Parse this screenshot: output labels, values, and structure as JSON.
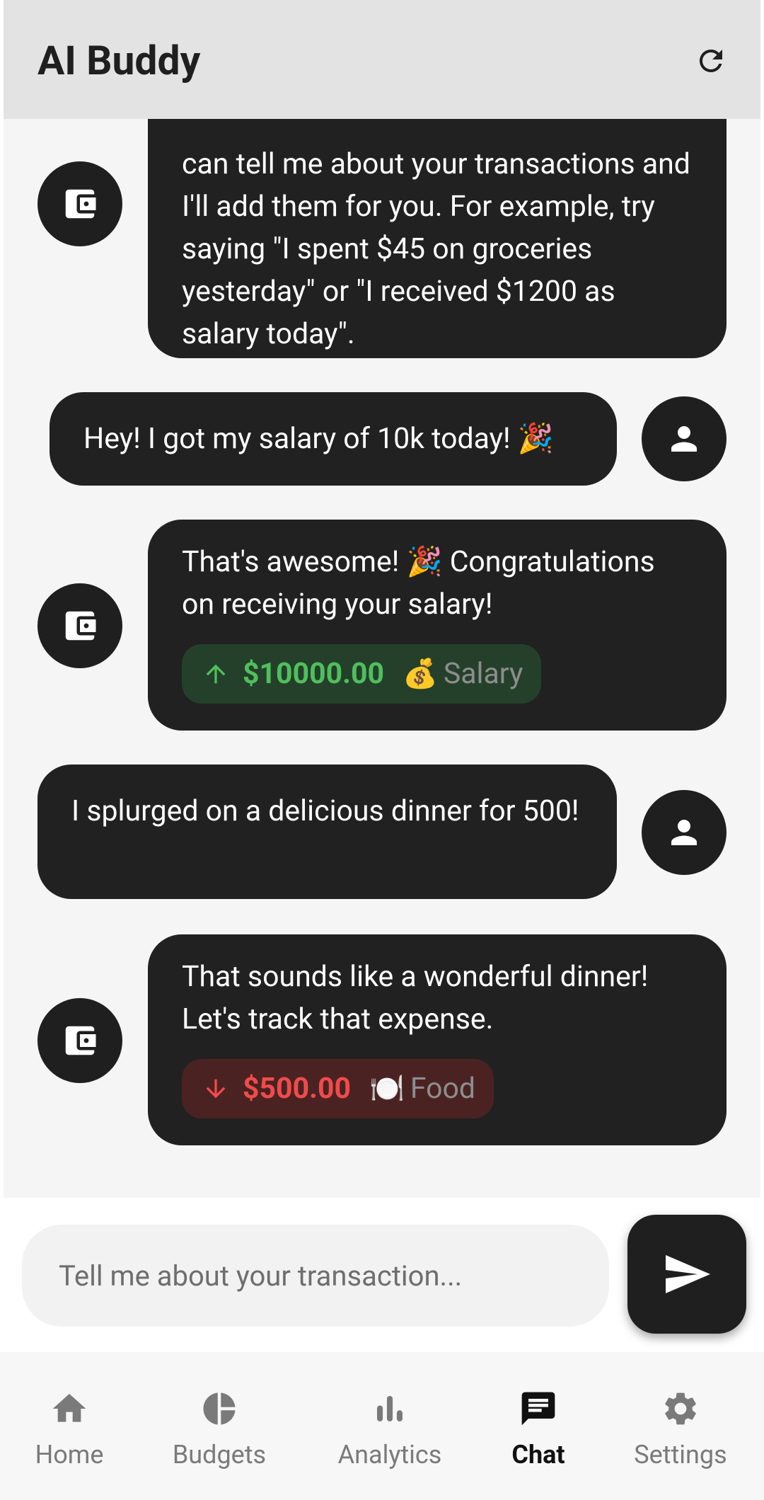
{
  "app_bar": {
    "title": "AI Buddy",
    "refresh_icon": "refresh-icon"
  },
  "messages": [
    {
      "sender": "bot",
      "icon": "wallet-icon",
      "text": "can tell me about your transactions and I'll add them for you. For example, try saying \"I spent $45 on groceries yesterday\" or \"I received $1200 as salary today\"."
    },
    {
      "sender": "user",
      "icon": "person-icon",
      "text": "Hey! I got my salary of 10k today! 🎉"
    },
    {
      "sender": "bot",
      "icon": "wallet-icon",
      "text": "That's awesome! 🎉 Congratulations on receiving your salary!",
      "transaction": {
        "type": "income",
        "amount": "$10000.00",
        "emoji": "💰",
        "category": "Salary"
      }
    },
    {
      "sender": "user",
      "icon": "person-icon",
      "text": "I splurged on a delicious dinner for 500!"
    },
    {
      "sender": "bot",
      "icon": "wallet-icon",
      "text": "That sounds like a wonderful dinner! Let's track that expense.",
      "transaction": {
        "type": "expense",
        "amount": "$500.00",
        "emoji": "🍽️",
        "category": "Food"
      }
    }
  ],
  "composer": {
    "placeholder": "Tell me about your transaction...",
    "value": "",
    "send_icon": "send-icon"
  },
  "nav": {
    "items": [
      {
        "label": "Home",
        "icon": "home-icon",
        "active": false
      },
      {
        "label": "Budgets",
        "icon": "pie-chart-icon",
        "active": false
      },
      {
        "label": "Analytics",
        "icon": "bar-chart-icon",
        "active": false
      },
      {
        "label": "Chat",
        "icon": "chat-icon",
        "active": true
      },
      {
        "label": "Settings",
        "icon": "gear-icon",
        "active": false
      }
    ]
  },
  "colors": {
    "income": "#4fbf5c",
    "expense": "#ef4b4b",
    "bubble": "#212121",
    "app_bar": "#e3e3e3"
  }
}
